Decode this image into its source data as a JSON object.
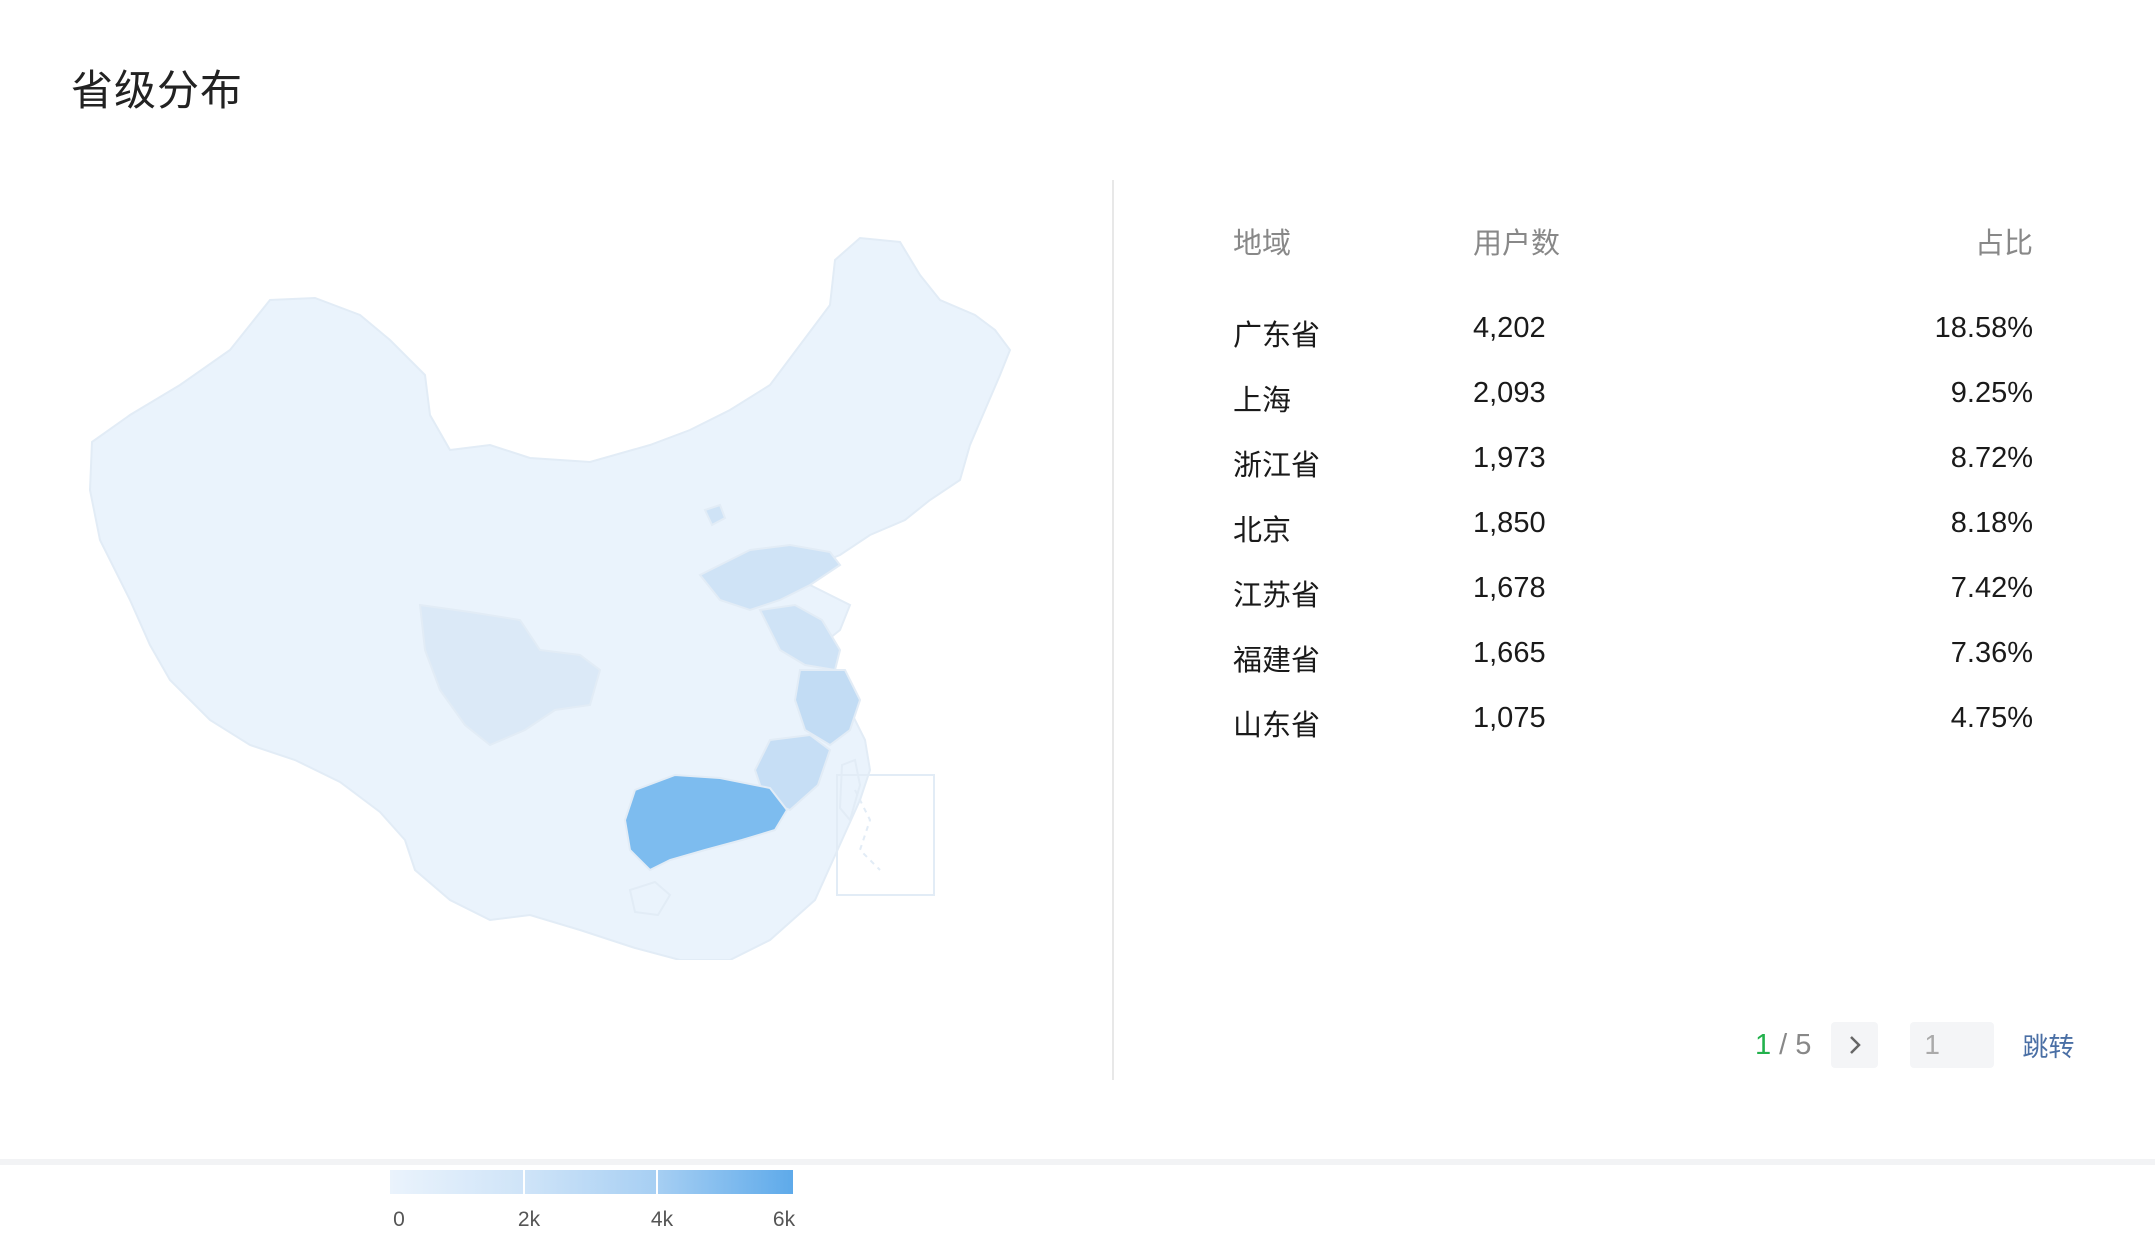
{
  "title": "省级分布",
  "legend": {
    "labels": [
      "0",
      "2k",
      "4k",
      "6k"
    ]
  },
  "table": {
    "headers": {
      "region": "地域",
      "users": "用户数",
      "ratio": "占比"
    },
    "rows": [
      {
        "region": "广东省",
        "users": "4,202",
        "ratio": "18.58%"
      },
      {
        "region": "上海",
        "users": "2,093",
        "ratio": "9.25%"
      },
      {
        "region": "浙江省",
        "users": "1,973",
        "ratio": "8.72%"
      },
      {
        "region": "北京",
        "users": "1,850",
        "ratio": "8.18%"
      },
      {
        "region": "江苏省",
        "users": "1,678",
        "ratio": "7.42%"
      },
      {
        "region": "福建省",
        "users": "1,665",
        "ratio": "7.36%"
      },
      {
        "region": "山东省",
        "users": "1,075",
        "ratio": "4.75%"
      }
    ]
  },
  "pager": {
    "current": "1",
    "separator": "/",
    "total": "5",
    "input_value": "1",
    "jump_label": "跳转"
  },
  "colors": {
    "accent": "#22b14c",
    "map_high": "#7dbcef",
    "map_low": "#eaf3fc"
  }
}
